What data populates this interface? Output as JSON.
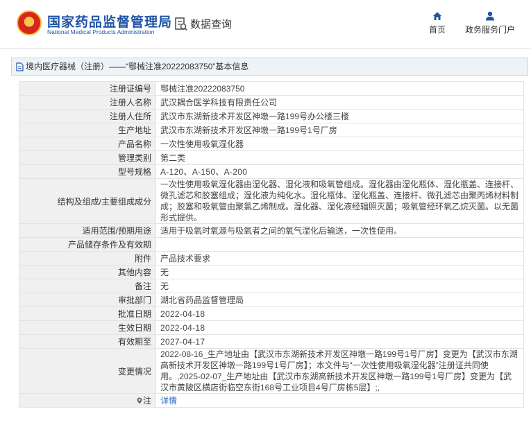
{
  "header": {
    "logo_cn": "国家药品监督管理局",
    "logo_en": "National Medical Products Administration",
    "query_label": "数据查询",
    "nav": [
      {
        "label": "首页",
        "icon": "home-icon"
      },
      {
        "label": "政务服务门户",
        "icon": "user-icon"
      }
    ]
  },
  "title_bar": {
    "text": "境内医疗器械（注册）——“鄂械注准20222083750”基本信息"
  },
  "rows": [
    {
      "label": "注册证编号",
      "value": "鄂械注准20222083750"
    },
    {
      "label": "注册人名称",
      "value": "武汉耦合医学科技有限责任公司"
    },
    {
      "label": "注册人住所",
      "value": "武汉市东湖新技术开发区神墩一路199号办公楼三楼"
    },
    {
      "label": "生产地址",
      "value": "武汉市东湖新技术开发区神墩一路199号1号厂房"
    },
    {
      "label": "产品名称",
      "value": "一次性使用吸氧湿化器"
    },
    {
      "label": "管理类别",
      "value": "第二类"
    },
    {
      "label": "型号规格",
      "value": "A-120、A-150、A-200"
    },
    {
      "label": "结构及组成/主要组成成分",
      "value": "一次性使用吸氧湿化器由湿化器、湿化液和吸氧管组成。湿化器由湿化瓶体、湿化瓶盖、连接杆、微孔滤芯和胶塞组成；湿化液为纯化水。湿化瓶体、湿化瓶盖、连接杆、微孔滤芯由聚丙烯材料制成；胶塞和吸氧管由聚氯乙烯制成。湿化器、湿化液经辐照灭菌；吸氧管经环氧乙烷灭菌。以无菌形式提供。"
    },
    {
      "label": "适用范围/预期用途",
      "value": "适用于吸氧时氧源与吸氧者之间的氧气湿化后输送，一次性使用。"
    },
    {
      "label": "产品储存条件及有效期",
      "value": ""
    },
    {
      "label": "附件",
      "value": "产品技术要求"
    },
    {
      "label": "其他内容",
      "value": "无"
    },
    {
      "label": "备注",
      "value": "无"
    },
    {
      "label": "审批部门",
      "value": "湖北省药品监督管理局"
    },
    {
      "label": "批准日期",
      "value": "2022-04-18"
    },
    {
      "label": "生效日期",
      "value": "2022-04-18"
    },
    {
      "label": "有效期至",
      "value": "2027-04-17"
    },
    {
      "label": "变更情况",
      "value": "2022-08-16_生产地址由【武汉市东湖新技术开发区神墩一路199号1号厂房】变更为【武汉市东湖高新技术开发区神墩一路199号1号厂房】；本文件与“一次性使用吸氧湿化器”注册证共同使用。,2025-02-07_生产地址由【武汉市东湖高新技术开发区神墩一路199号1号厂房】变更为【武汉市黄陂区横店街临空东街168号工业项目4号厂房栋5层】;,"
    }
  ],
  "note_row": {
    "label": "注",
    "link": "详情",
    "icon": "location-pin-icon"
  }
}
